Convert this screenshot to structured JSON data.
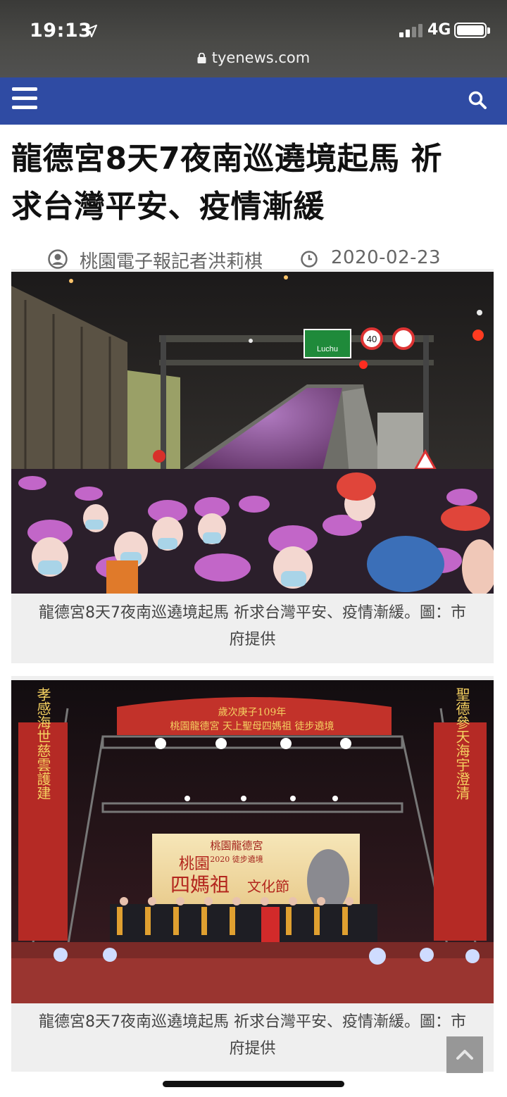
{
  "status_bar": {
    "time": "19:13",
    "network": "4G",
    "url": "tyenews.com"
  },
  "navbar": {
    "background": "#2f4ba3",
    "menu_icon": "hamburger-menu-icon",
    "search_icon": "search-icon"
  },
  "article": {
    "headline_line1": "龍德宮8天7夜南巡遶境起馬 祈",
    "headline_line2": "求台灣平安、疫情漸緩",
    "author": "桃園電子報記者洪莉棋",
    "date": "2020-02-23",
    "figures": [
      {
        "caption_line1": "龍德宮8天7夜南巡遶境起馬 祈求台灣平安、疫情漸緩。圖：市",
        "caption_line2": "府提供",
        "sign_text": "Luchu",
        "speed_sign": "40"
      },
      {
        "caption_line1": "龍德宮8天7夜南巡遶境起馬 祈求台灣平安、疫情漸緩。圖：市",
        "caption_line2": "府提供",
        "banner_top_line1": "歲次庚子109年",
        "banner_top_line2": "桃園龍德宮 天上聖母四媽祖 徒步遶境",
        "screen_line1": "桃園龍德宮",
        "screen_line2": "2020 徒步遶境",
        "screen_title_a": "桃園",
        "screen_title_b": "四媽祖",
        "screen_title_c": "文化節",
        "left_banner": "孝感海世慈雲護建",
        "right_banner": "聖德參天海宇澄清"
      }
    ]
  },
  "back_to_top_icon": "chevron-up-icon"
}
